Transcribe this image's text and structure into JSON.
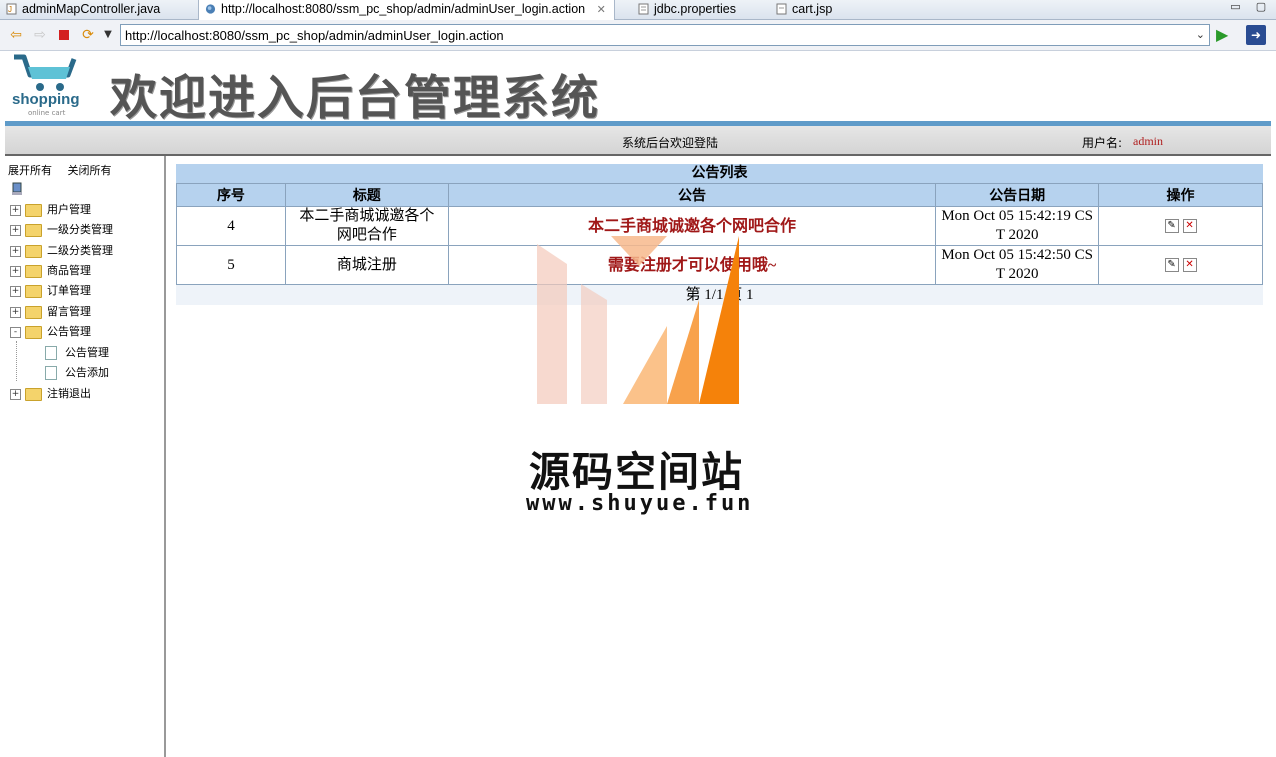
{
  "ide": {
    "tabs": [
      {
        "label": "adminMapController.java"
      },
      {
        "label": "http://localhost:8080/ssm_pc_shop/admin/adminUser_login.action"
      },
      {
        "label": "jdbc.properties"
      },
      {
        "label": "cart.jsp"
      }
    ]
  },
  "browser": {
    "url": "http://localhost:8080/ssm_pc_shop/admin/adminUser_login.action"
  },
  "header": {
    "logo_text": "shopping",
    "logo_sub": "online cart",
    "title": "欢迎进入后台管理系统",
    "welcome": "系统后台欢迎登陆",
    "user_label": "用户名:",
    "user_name": "admin"
  },
  "sidebar": {
    "expand_all": "展开所有",
    "collapse_all": "关闭所有",
    "items": [
      {
        "label": "用户管理",
        "state": "+"
      },
      {
        "label": "一级分类管理",
        "state": "+"
      },
      {
        "label": "二级分类管理",
        "state": "+"
      },
      {
        "label": "商品管理",
        "state": "+"
      },
      {
        "label": "订单管理",
        "state": "+"
      },
      {
        "label": "留言管理",
        "state": "+"
      },
      {
        "label": "公告管理",
        "state": "-"
      },
      {
        "label": "注销退出",
        "state": "+"
      }
    ],
    "children": [
      {
        "label": "公告管理"
      },
      {
        "label": "公告添加"
      }
    ]
  },
  "table": {
    "title": "公告列表",
    "headers": [
      "序号",
      "标题",
      "公告",
      "公告日期",
      "操作"
    ],
    "rows": [
      {
        "id": "4",
        "title": "本二手商城诚邀各个网吧合作",
        "notice": "本二手商城诚邀各个网吧合作",
        "date": "Mon Oct 05 15:42:19 CST 2020"
      },
      {
        "id": "5",
        "title": "商城注册",
        "notice": "需要注册才可以使用哦~",
        "date": "Mon Oct 05 15:42:50 CST 2020"
      }
    ],
    "pager": "第 1/1 页 1"
  },
  "watermark": {
    "title": "源码空间站",
    "url": "www.shuyue.fun"
  },
  "colors": {
    "header_blue": "#5f9bc9",
    "table_header": "#b6d2ee",
    "notice_red": "#a01818",
    "watermark_orange": "#f5820a"
  }
}
